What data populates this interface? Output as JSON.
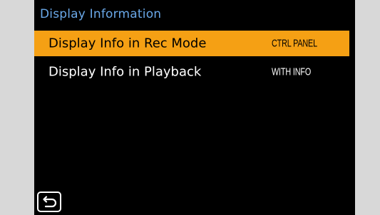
{
  "header": {
    "title": "Display Information"
  },
  "menu": {
    "items": [
      {
        "label": "Display Info in Rec Mode",
        "value": "CTRL PANEL",
        "selected": true
      },
      {
        "label": "Display Info in Playback",
        "value": "WITH INFO",
        "selected": false
      }
    ]
  },
  "footer": {
    "back_icon": "return-arrow-icon"
  },
  "colors": {
    "title": "#6aa8e8",
    "selection": "#f5a014",
    "background": "#000000",
    "side_panel": "#d8d8d8"
  }
}
